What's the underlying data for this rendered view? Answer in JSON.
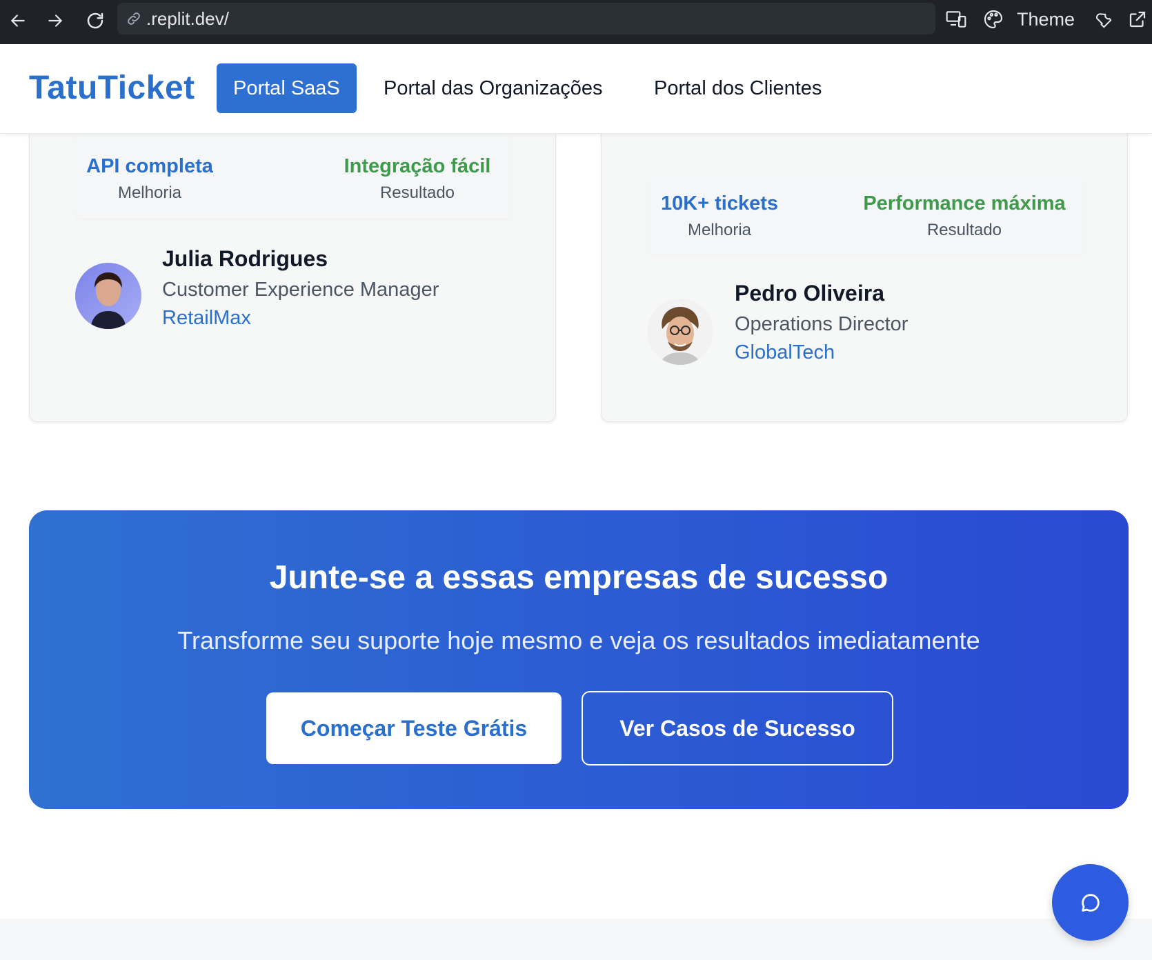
{
  "browser": {
    "url": ".replit.dev/",
    "theme_label": "Theme"
  },
  "header": {
    "brand": "TatuTicket",
    "tabs": [
      {
        "label": "Portal SaaS",
        "active": true
      },
      {
        "label": "Portal das Organizações",
        "active": false
      },
      {
        "label": "Portal dos Clientes",
        "active": false
      }
    ]
  },
  "testimonials": [
    {
      "metrics": [
        {
          "value": "API completa",
          "caption": "Melhoria",
          "color": "#2b6fcc"
        },
        {
          "value": "Integração fácil",
          "caption": "Resultado",
          "color": "#3f9a4c"
        }
      ],
      "name": "Julia Rodrigues",
      "role": "Customer Experience Manager",
      "company": "RetailMax"
    },
    {
      "metrics": [
        {
          "value": "10K+ tickets",
          "caption": "Melhoria",
          "color": "#2b6fcc"
        },
        {
          "value": "Performance máxima",
          "caption": "Resultado",
          "color": "#3f9a4c"
        }
      ],
      "name": "Pedro Oliveira",
      "role": "Operations Director",
      "company": "GlobalTech"
    }
  ],
  "cta": {
    "title": "Junte-se a essas empresas de sucesso",
    "subtitle": "Transforme seu suporte hoje mesmo e veja os resultados imediatamente",
    "primary_button": "Começar Teste Grátis",
    "secondary_button": "Ver Casos de Sucesso"
  },
  "colors": {
    "brand": "#2b6fcc",
    "success": "#3f9a4c",
    "cta_gradient_start": "#2f70d1",
    "cta_gradient_end": "#2a49d2",
    "chat_button": "#2e5ce0"
  },
  "icons": [
    "back-arrow-icon",
    "forward-arrow-icon",
    "reload-icon",
    "link-icon",
    "devices-icon",
    "palette-icon",
    "wrench-icon",
    "external-link-icon",
    "chat-bubble-icon"
  ]
}
